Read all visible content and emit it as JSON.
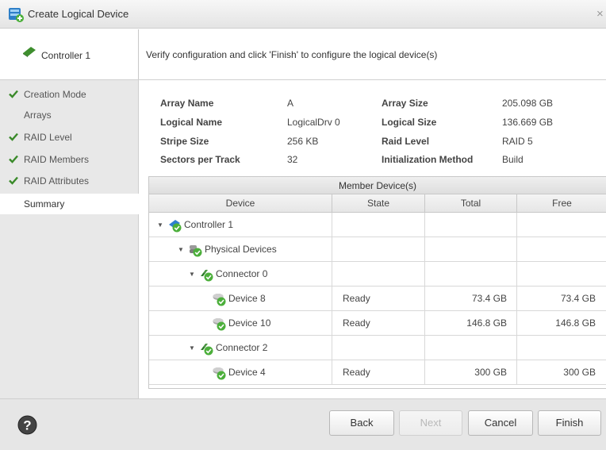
{
  "window": {
    "title": "Create Logical Device",
    "close_glyph": "×"
  },
  "header": {
    "controller_label": "Controller 1",
    "instruction": "Verify configuration and click 'Finish' to configure the logical device(s)"
  },
  "steps": [
    {
      "label": "Creation Mode",
      "done": true
    },
    {
      "label": "Arrays",
      "done": false
    },
    {
      "label": "RAID Level",
      "done": true
    },
    {
      "label": "RAID Members",
      "done": true
    },
    {
      "label": "RAID Attributes",
      "done": true
    },
    {
      "label": "Summary",
      "done": false,
      "active": true
    }
  ],
  "summary": {
    "array_name_label": "Array Name",
    "array_name": "A",
    "logical_name_label": "Logical Name",
    "logical_name": "LogicalDrv 0",
    "stripe_size_label": "Stripe Size",
    "stripe_size": "256 KB",
    "sectors_label": "Sectors per Track",
    "sectors": "32",
    "array_size_label": "Array Size",
    "array_size": "205.098 GB",
    "logical_size_label": "Logical Size",
    "logical_size": "136.669 GB",
    "raid_level_label": "Raid Level",
    "raid_level": "RAID 5",
    "init_method_label": "Initialization Method",
    "init_method": "Build"
  },
  "table": {
    "caption": "Member Device(s)",
    "columns": [
      "Device",
      "State",
      "Total",
      "Free"
    ],
    "rows": [
      {
        "name": "Controller 1",
        "icon": "controller-icon",
        "expanded": true,
        "state": "",
        "total": "",
        "free": ""
      },
      {
        "name": "Physical Devices",
        "icon": "physical-devices-icon",
        "expanded": true,
        "state": "",
        "total": "",
        "free": ""
      },
      {
        "name": "Connector 0",
        "icon": "connector-icon",
        "expanded": true,
        "state": "",
        "total": "",
        "free": ""
      },
      {
        "name": "Device 8",
        "icon": "disk-icon",
        "expanded": false,
        "state": "Ready",
        "total": "73.4 GB",
        "free": "73.4 GB"
      },
      {
        "name": "Device 10",
        "icon": "disk-icon",
        "expanded": false,
        "state": "Ready",
        "total": "146.8 GB",
        "free": "146.8 GB"
      },
      {
        "name": "Connector 2",
        "icon": "connector-icon",
        "expanded": true,
        "state": "",
        "total": "",
        "free": ""
      },
      {
        "name": "Device 4",
        "icon": "disk-icon",
        "expanded": false,
        "state": "Ready",
        "total": "300 GB",
        "free": "300 GB"
      }
    ]
  },
  "footer": {
    "help_icon": "help-icon",
    "back": "Back",
    "next": "Next",
    "cancel": "Cancel",
    "finish": "Finish"
  },
  "colors": {
    "check": "#3a8a2a",
    "accent": "#2a8ad2",
    "help": "#444444"
  }
}
